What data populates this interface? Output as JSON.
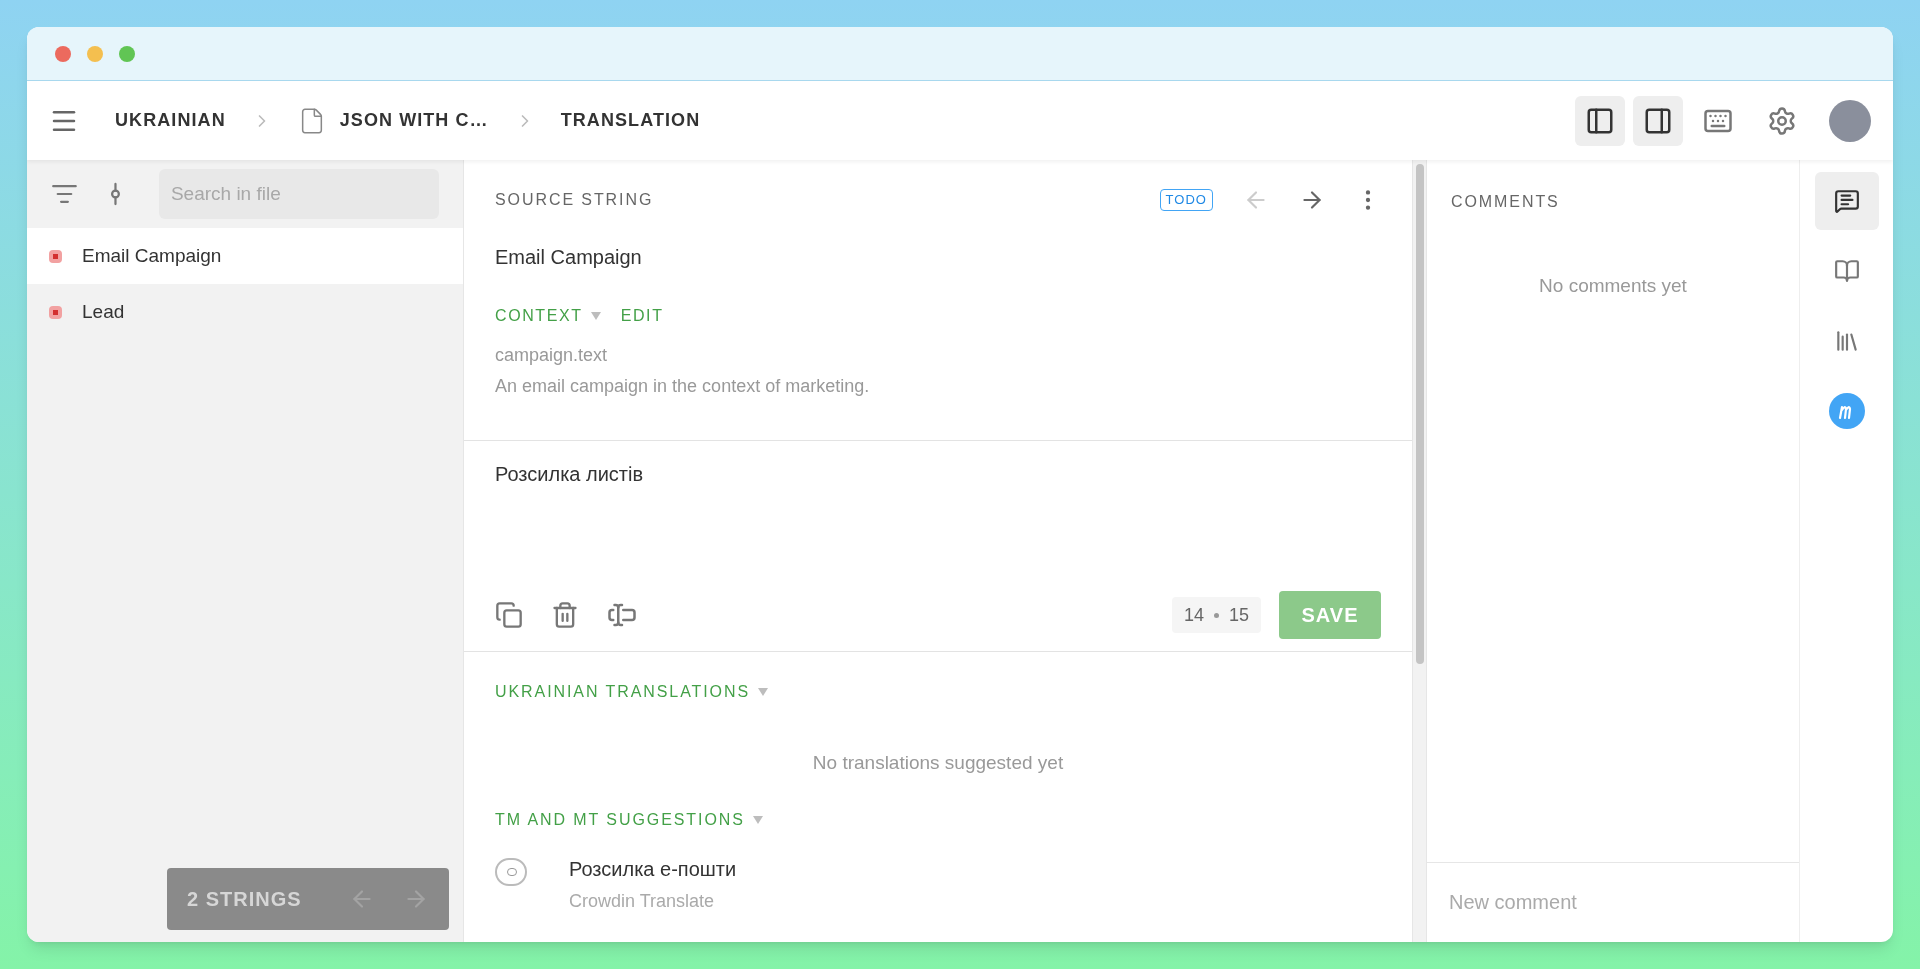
{
  "header": {
    "breadcrumbs": [
      {
        "label": "UKRAINIAN",
        "kind": "text"
      },
      {
        "label": "JSON WITH C…",
        "kind": "file"
      },
      {
        "label": "TRANSLATION",
        "kind": "text"
      }
    ],
    "layout_toggles": [
      {
        "kind": "left",
        "selected": true
      },
      {
        "kind": "right",
        "selected": true
      }
    ]
  },
  "sidebar": {
    "search": {
      "placeholder": "Search in file"
    },
    "strings": [
      {
        "label": "Email Campaign",
        "selected": true
      },
      {
        "label": "Lead",
        "selected": false
      }
    ],
    "footer": {
      "count": "2 STRINGS",
      "prev_disabled": true,
      "next_disabled": true
    }
  },
  "editor": {
    "title": "SOURCE STRING",
    "status": "TODO",
    "prev_disabled": true,
    "next_disabled": false,
    "source_text": "Email Campaign",
    "context_label": "CONTEXT",
    "edit_label": "EDIT",
    "key": "campaign.text",
    "description": "An email campaign in the context of marketing.",
    "translation": "Розсилка листів",
    "counter": {
      "current": "14",
      "limit": "15"
    },
    "save": "SAVE"
  },
  "sections": [
    {
      "title": "UKRAINIAN TRANSLATIONS",
      "empty": "No translations suggested yet"
    },
    {
      "title": "TM AND MT SUGGESTIONS",
      "suggestions": [
        {
          "text": "Розсилка е-пошти",
          "source": "Crowdin Translate"
        }
      ]
    }
  ],
  "comments": {
    "title": "COMMENTS",
    "empty": "No comments yet",
    "placeholder": "New comment"
  },
  "rail": [
    {
      "kind": "comments",
      "selected": true
    },
    {
      "kind": "panel",
      "selected": false
    },
    {
      "kind": "library",
      "selected": false
    },
    {
      "kind": "logo",
      "selected": false
    }
  ]
}
